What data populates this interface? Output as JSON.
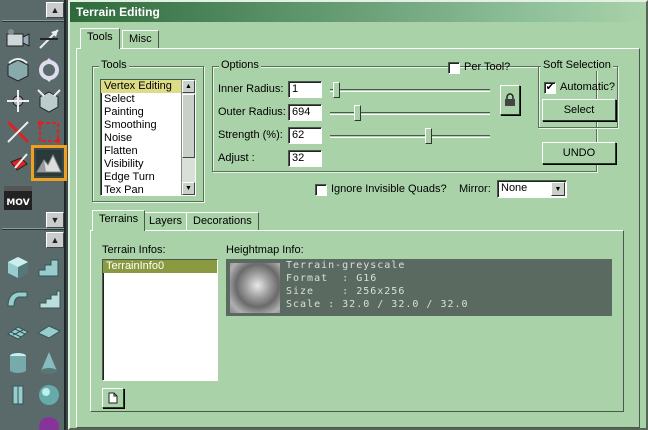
{
  "window": {
    "title": "Terrain Editing"
  },
  "main_tabs": [
    {
      "label": "Tools"
    },
    {
      "label": "Misc"
    }
  ],
  "tools_group": {
    "title": "Tools",
    "items": [
      "Vertex Editing",
      "Select",
      "Painting",
      "Smoothing",
      "Noise",
      "Flatten",
      "Visibility",
      "Edge Turn",
      "Tex Pan"
    ],
    "selected": "Vertex Editing"
  },
  "options_group": {
    "title": "Options",
    "per_tool_label": "Per Tool?",
    "per_tool_checked": false,
    "inner_radius": {
      "label": "Inner Radius:",
      "value": "1",
      "slider_fraction": 0.02
    },
    "outer_radius": {
      "label": "Outer Radius:",
      "value": "694",
      "slider_fraction": 0.16
    },
    "strength": {
      "label": "Strength (%):",
      "value": "62",
      "slider_fraction": 0.62
    },
    "adjust": {
      "label": "Adjust :",
      "value": "32"
    },
    "lock_icon": "padlock-icon"
  },
  "soft_selection": {
    "title": "Soft Selection",
    "automatic_label": "Automatic?",
    "automatic_checked": true,
    "select_button": "Select"
  },
  "undo_button": "UNDO",
  "ignore_quads": {
    "label": "Ignore Invisible Quads?",
    "checked": false
  },
  "mirror": {
    "label": "Mirror:",
    "value": "None"
  },
  "sub_tabs": [
    {
      "label": "Terrains"
    },
    {
      "label": "Layers"
    },
    {
      "label": "Decorations"
    }
  ],
  "terrain_infos": {
    "label": "Terrain Infos:",
    "items": [
      "TerrainInfo0"
    ]
  },
  "heightmap_info": {
    "label": "Heightmap Info:",
    "name": "Terrain-greyscale",
    "format": "Format  : G16",
    "size": "Size    : 256x256",
    "scale": "Scale : 32.0 / 32.0 / 32.0"
  },
  "new_button_icon": "new-document-icon",
  "colors": {
    "window_bg": "#a9d2a8",
    "title_start": "#2e6a3c",
    "selection_highlight": "#f0a020"
  }
}
